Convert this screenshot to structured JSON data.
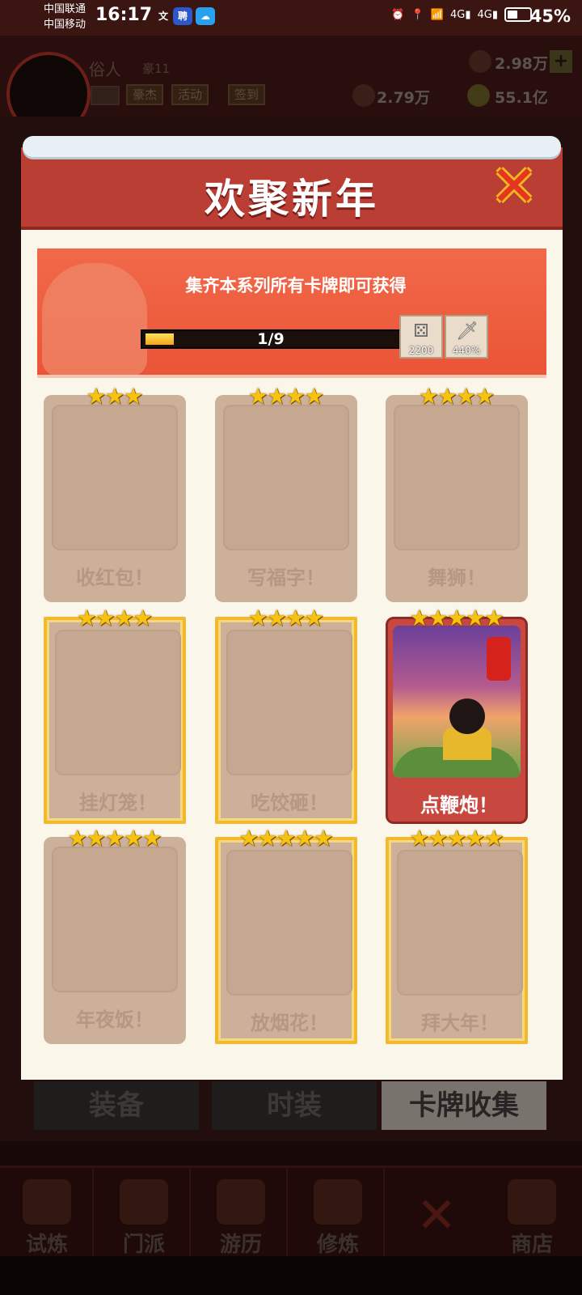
{
  "status_bar": {
    "carrier1": "中国联通",
    "carrier2": "中国移动",
    "time": "16:17",
    "battery": "45%",
    "net1": "4G",
    "net2": "4G"
  },
  "header": {
    "player_name": "俗人",
    "player_rank": "豪11",
    "buttons": [
      "豪杰",
      "活动",
      "签到"
    ],
    "currency_top": "2.98万",
    "currency_mid": "2.79万",
    "currency_gold": "55.1亿"
  },
  "modal": {
    "title": "欢聚新年",
    "banner_text": "集齐本系列所有卡牌即可获得",
    "progress": {
      "text": "1/9",
      "fraction": 0.111
    },
    "rewards": [
      {
        "icon": "dice-icon",
        "value": "2200"
      },
      {
        "icon": "sword-icon",
        "value": "440%"
      }
    ],
    "cards": [
      {
        "label": "收红包！",
        "stars": "★★★",
        "owned": false,
        "gold": false
      },
      {
        "label": "写福字！",
        "stars": "★★★★",
        "owned": false,
        "gold": false
      },
      {
        "label": "舞狮！",
        "stars": "★★★★",
        "owned": false,
        "gold": false
      },
      {
        "label": "挂灯笼！",
        "stars": "★★★★",
        "owned": false,
        "gold": true
      },
      {
        "label": "吃饺砸！",
        "stars": "★★★★",
        "owned": false,
        "gold": true
      },
      {
        "label": "点鞭炮！",
        "stars": "★★★★★",
        "owned": true,
        "gold": false
      },
      {
        "label": "年夜饭！",
        "stars": "★★★★★",
        "owned": false,
        "gold": false
      },
      {
        "label": "放烟花！",
        "stars": "★★★★★",
        "owned": false,
        "gold": true
      },
      {
        "label": "拜大年！",
        "stars": "★★★★★",
        "owned": false,
        "gold": true
      }
    ]
  },
  "bottom_tabs": [
    "装备",
    "时装",
    "卡牌收集"
  ],
  "nav": [
    "试炼",
    "门派",
    "游历",
    "修炼",
    "商店"
  ],
  "colors": {
    "accent_red": "#bb3e35",
    "gold": "#f2b82e",
    "card_empty": "#cdb09a"
  }
}
